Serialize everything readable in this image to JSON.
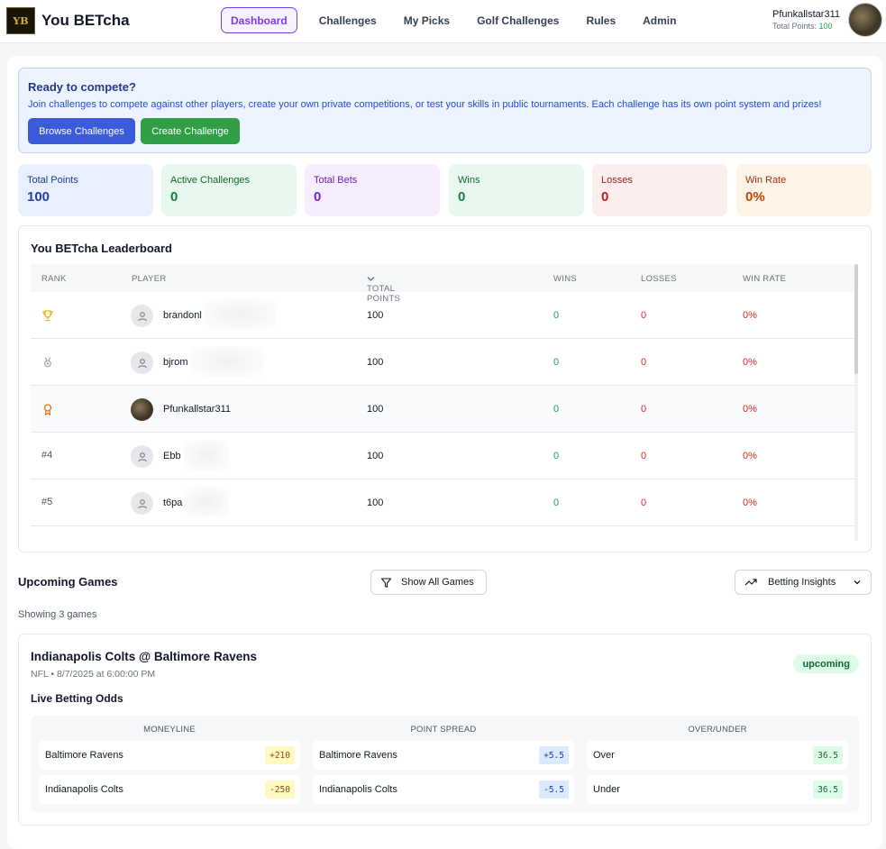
{
  "header": {
    "brand": "You BETcha",
    "logo_text": "YB",
    "nav": [
      "Dashboard",
      "Challenges",
      "My Picks",
      "Golf Challenges",
      "Rules",
      "Admin"
    ],
    "user_name": "Pfunkallstar311",
    "points_label": "Total Points:",
    "points_value": "100"
  },
  "banner": {
    "title": "Ready to compete?",
    "text": "Join challenges to compete against other players, create your own private competitions, or test your skills in public tournaments. Each challenge has its own point system and prizes!",
    "browse_label": "Browse Challenges",
    "create_label": "Create Challenge"
  },
  "stats": [
    {
      "label": "Total Points",
      "value": "100"
    },
    {
      "label": "Active Challenges",
      "value": "0"
    },
    {
      "label": "Total Bets",
      "value": "0"
    },
    {
      "label": "Wins",
      "value": "0"
    },
    {
      "label": "Losses",
      "value": "0"
    },
    {
      "label": "Win Rate",
      "value": "0%"
    }
  ],
  "leaderboard": {
    "title": "You BETcha Leaderboard",
    "columns": [
      "RANK",
      "PLAYER",
      "TOTAL POINTS",
      "WINS",
      "LOSSES",
      "WIN RATE"
    ],
    "rows": [
      {
        "rank": "",
        "rank_icon": "trophy-icon",
        "player": "brandonl",
        "points": "100",
        "wins": "0",
        "losses": "0",
        "rate": "0%"
      },
      {
        "rank": "",
        "rank_icon": "medal-silver-icon",
        "player": "bjrom",
        "points": "100",
        "wins": "0",
        "losses": "0",
        "rate": "0%"
      },
      {
        "rank": "",
        "rank_icon": "medal-bronze-icon",
        "player": "Pfunkallstar311",
        "points": "100",
        "wins": "0",
        "losses": "0",
        "rate": "0%"
      },
      {
        "rank": "#4",
        "player": "Ebb",
        "points": "100",
        "wins": "0",
        "losses": "0",
        "rate": "0%"
      },
      {
        "rank": "#5",
        "player": "t6pa",
        "points": "100",
        "wins": "0",
        "losses": "0",
        "rate": "0%"
      }
    ]
  },
  "upcoming": {
    "title": "Upcoming Games",
    "show_all_label": "Show All Games",
    "insights_label": "Betting Insights",
    "count_text": "Showing 3 games"
  },
  "game": {
    "title": "Indianapolis Colts @ Baltimore Ravens",
    "meta": "NFL • 8/7/2025 at 6:00:00 PM",
    "status": "upcoming",
    "odds_title": "Live Betting Odds",
    "columns": [
      {
        "header": "MONEYLINE",
        "rows": [
          {
            "team": "Baltimore Ravens",
            "value": "+210"
          },
          {
            "team": "Indianapolis Colts",
            "value": "-250"
          }
        ]
      },
      {
        "header": "POINT SPREAD",
        "rows": [
          {
            "team": "Baltimore Ravens",
            "value": "+5.5"
          },
          {
            "team": "Indianapolis Colts",
            "value": "-5.5"
          }
        ]
      },
      {
        "header": "OVER/UNDER",
        "rows": [
          {
            "team": "Over",
            "value": "36.5"
          },
          {
            "team": "Under",
            "value": "36.5"
          }
        ]
      }
    ]
  },
  "colors": {
    "accent": "#7c3aed",
    "primary_button": "#3b5bdb",
    "success_button": "#2f9e44",
    "win": "#16a34a",
    "loss": "#dc2626"
  }
}
